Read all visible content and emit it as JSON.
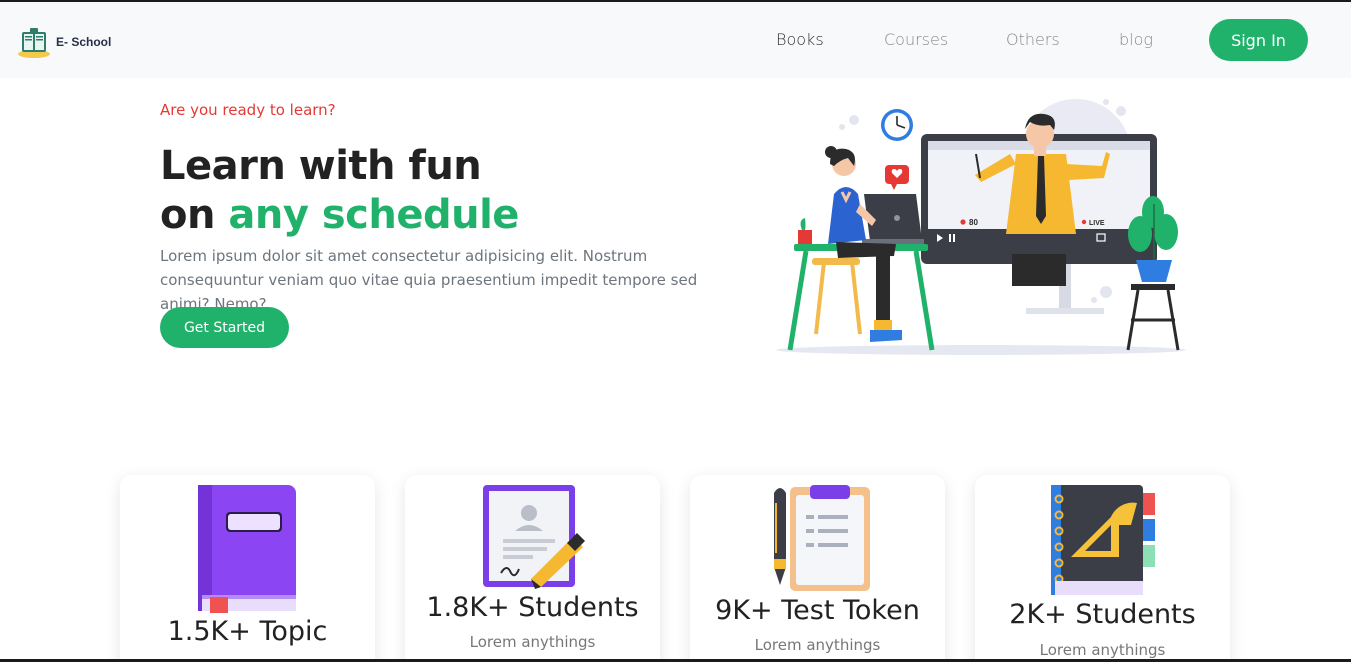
{
  "header": {
    "logo_text": "E- School",
    "nav": [
      "Books",
      "Courses",
      "Others",
      "blog"
    ],
    "signin_label": "Sign In"
  },
  "hero": {
    "eyebrow": "Are you ready to learn?",
    "title_line1": "Learn with fun",
    "title_line2_prefix": "on ",
    "title_line2_highlight": "any schedule",
    "description": "Lorem ipsum dolor sit amet consectetur adipisicing elit. Nostrum consequuntur veniam quo vitae quia praesentium impedit tempore sed animi? Nemo?",
    "cta_label": "Get Started",
    "illustration": {
      "viewers_count": "80",
      "live_label": "LIVE"
    }
  },
  "stats": [
    {
      "title": "1.5K+ Topic",
      "subtitle": "",
      "icon": "book-icon"
    },
    {
      "title": "1.8K+ Students",
      "subtitle": "Lorem anythings",
      "icon": "certificate-icon"
    },
    {
      "title": "9K+ Test Token",
      "subtitle": "Lorem anythings",
      "icon": "clipboard-icon"
    },
    {
      "title": "2K+ Students",
      "subtitle": "Lorem anythings",
      "icon": "notebook-icon"
    }
  ],
  "colors": {
    "accent": "#20b26b",
    "eyebrow": "#e53935",
    "header_bg": "#f8f9fa"
  }
}
